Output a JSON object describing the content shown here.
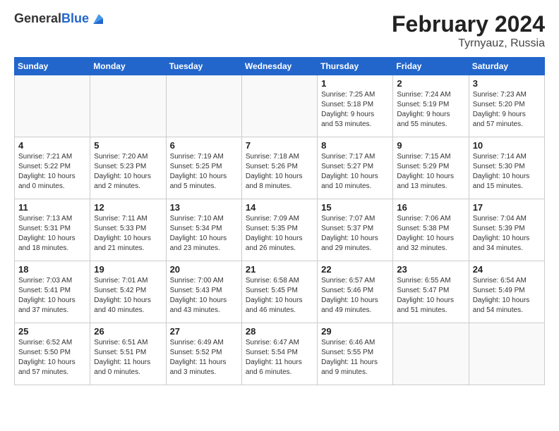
{
  "header": {
    "logo_general": "General",
    "logo_blue": "Blue",
    "month_title": "February 2024",
    "location": "Tyrnyauz, Russia"
  },
  "weekdays": [
    "Sunday",
    "Monday",
    "Tuesday",
    "Wednesday",
    "Thursday",
    "Friday",
    "Saturday"
  ],
  "weeks": [
    [
      {
        "day": "",
        "info": ""
      },
      {
        "day": "",
        "info": ""
      },
      {
        "day": "",
        "info": ""
      },
      {
        "day": "",
        "info": ""
      },
      {
        "day": "1",
        "info": "Sunrise: 7:25 AM\nSunset: 5:18 PM\nDaylight: 9 hours\nand 53 minutes."
      },
      {
        "day": "2",
        "info": "Sunrise: 7:24 AM\nSunset: 5:19 PM\nDaylight: 9 hours\nand 55 minutes."
      },
      {
        "day": "3",
        "info": "Sunrise: 7:23 AM\nSunset: 5:20 PM\nDaylight: 9 hours\nand 57 minutes."
      }
    ],
    [
      {
        "day": "4",
        "info": "Sunrise: 7:21 AM\nSunset: 5:22 PM\nDaylight: 10 hours\nand 0 minutes."
      },
      {
        "day": "5",
        "info": "Sunrise: 7:20 AM\nSunset: 5:23 PM\nDaylight: 10 hours\nand 2 minutes."
      },
      {
        "day": "6",
        "info": "Sunrise: 7:19 AM\nSunset: 5:25 PM\nDaylight: 10 hours\nand 5 minutes."
      },
      {
        "day": "7",
        "info": "Sunrise: 7:18 AM\nSunset: 5:26 PM\nDaylight: 10 hours\nand 8 minutes."
      },
      {
        "day": "8",
        "info": "Sunrise: 7:17 AM\nSunset: 5:27 PM\nDaylight: 10 hours\nand 10 minutes."
      },
      {
        "day": "9",
        "info": "Sunrise: 7:15 AM\nSunset: 5:29 PM\nDaylight: 10 hours\nand 13 minutes."
      },
      {
        "day": "10",
        "info": "Sunrise: 7:14 AM\nSunset: 5:30 PM\nDaylight: 10 hours\nand 15 minutes."
      }
    ],
    [
      {
        "day": "11",
        "info": "Sunrise: 7:13 AM\nSunset: 5:31 PM\nDaylight: 10 hours\nand 18 minutes."
      },
      {
        "day": "12",
        "info": "Sunrise: 7:11 AM\nSunset: 5:33 PM\nDaylight: 10 hours\nand 21 minutes."
      },
      {
        "day": "13",
        "info": "Sunrise: 7:10 AM\nSunset: 5:34 PM\nDaylight: 10 hours\nand 23 minutes."
      },
      {
        "day": "14",
        "info": "Sunrise: 7:09 AM\nSunset: 5:35 PM\nDaylight: 10 hours\nand 26 minutes."
      },
      {
        "day": "15",
        "info": "Sunrise: 7:07 AM\nSunset: 5:37 PM\nDaylight: 10 hours\nand 29 minutes."
      },
      {
        "day": "16",
        "info": "Sunrise: 7:06 AM\nSunset: 5:38 PM\nDaylight: 10 hours\nand 32 minutes."
      },
      {
        "day": "17",
        "info": "Sunrise: 7:04 AM\nSunset: 5:39 PM\nDaylight: 10 hours\nand 34 minutes."
      }
    ],
    [
      {
        "day": "18",
        "info": "Sunrise: 7:03 AM\nSunset: 5:41 PM\nDaylight: 10 hours\nand 37 minutes."
      },
      {
        "day": "19",
        "info": "Sunrise: 7:01 AM\nSunset: 5:42 PM\nDaylight: 10 hours\nand 40 minutes."
      },
      {
        "day": "20",
        "info": "Sunrise: 7:00 AM\nSunset: 5:43 PM\nDaylight: 10 hours\nand 43 minutes."
      },
      {
        "day": "21",
        "info": "Sunrise: 6:58 AM\nSunset: 5:45 PM\nDaylight: 10 hours\nand 46 minutes."
      },
      {
        "day": "22",
        "info": "Sunrise: 6:57 AM\nSunset: 5:46 PM\nDaylight: 10 hours\nand 49 minutes."
      },
      {
        "day": "23",
        "info": "Sunrise: 6:55 AM\nSunset: 5:47 PM\nDaylight: 10 hours\nand 51 minutes."
      },
      {
        "day": "24",
        "info": "Sunrise: 6:54 AM\nSunset: 5:49 PM\nDaylight: 10 hours\nand 54 minutes."
      }
    ],
    [
      {
        "day": "25",
        "info": "Sunrise: 6:52 AM\nSunset: 5:50 PM\nDaylight: 10 hours\nand 57 minutes."
      },
      {
        "day": "26",
        "info": "Sunrise: 6:51 AM\nSunset: 5:51 PM\nDaylight: 11 hours\nand 0 minutes."
      },
      {
        "day": "27",
        "info": "Sunrise: 6:49 AM\nSunset: 5:52 PM\nDaylight: 11 hours\nand 3 minutes."
      },
      {
        "day": "28",
        "info": "Sunrise: 6:47 AM\nSunset: 5:54 PM\nDaylight: 11 hours\nand 6 minutes."
      },
      {
        "day": "29",
        "info": "Sunrise: 6:46 AM\nSunset: 5:55 PM\nDaylight: 11 hours\nand 9 minutes."
      },
      {
        "day": "",
        "info": ""
      },
      {
        "day": "",
        "info": ""
      }
    ]
  ]
}
